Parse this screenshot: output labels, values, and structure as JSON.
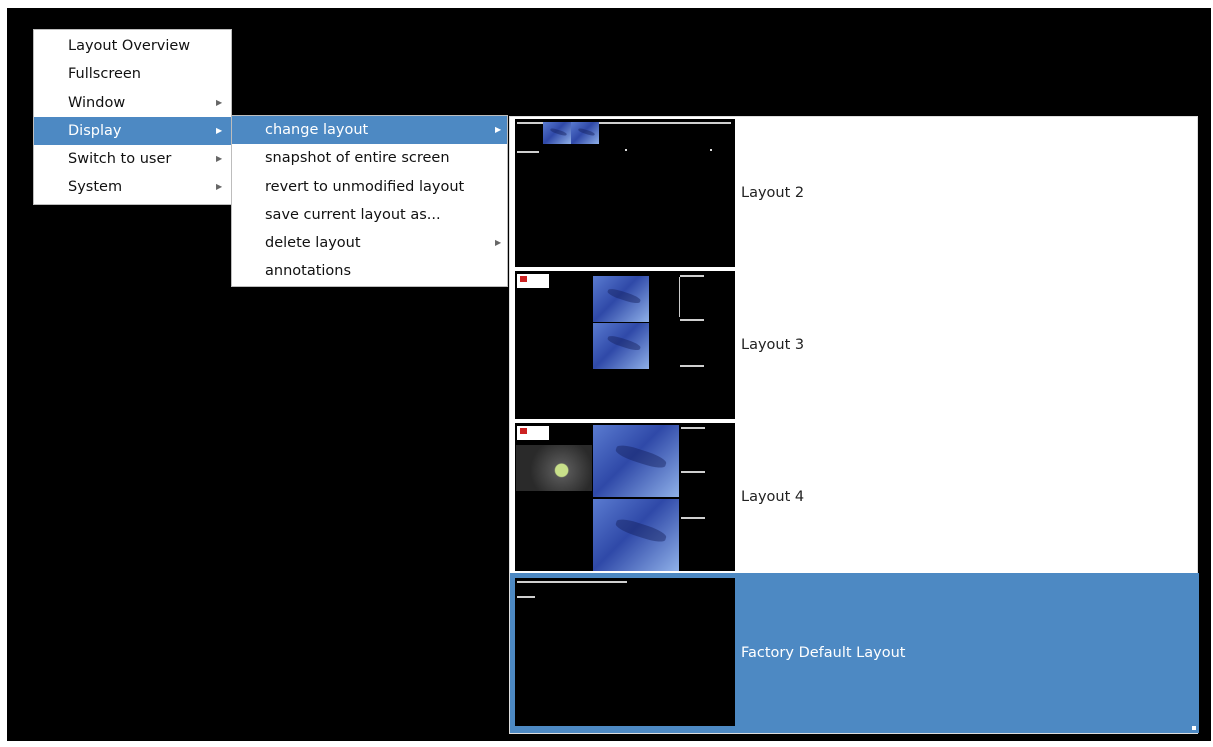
{
  "main_menu": {
    "items": [
      {
        "label": "Layout Overview",
        "has_submenu": false,
        "highlighted": false
      },
      {
        "label": "Fullscreen",
        "has_submenu": false,
        "highlighted": false
      },
      {
        "label": "Window",
        "has_submenu": true,
        "highlighted": false
      },
      {
        "label": "Display",
        "has_submenu": true,
        "highlighted": true
      },
      {
        "label": "Switch to user",
        "has_submenu": true,
        "highlighted": false
      },
      {
        "label": "System",
        "has_submenu": true,
        "highlighted": false
      }
    ]
  },
  "display_menu": {
    "items": [
      {
        "label": "change layout",
        "has_submenu": true,
        "highlighted": true
      },
      {
        "label": "snapshot of entire screen",
        "has_submenu": false,
        "highlighted": false
      },
      {
        "label": "revert to unmodified layout",
        "has_submenu": false,
        "highlighted": false
      },
      {
        "label": "save current layout as...",
        "has_submenu": false,
        "highlighted": false
      },
      {
        "label": "delete layout",
        "has_submenu": true,
        "highlighted": false
      },
      {
        "label": "annotations",
        "has_submenu": false,
        "highlighted": false
      }
    ]
  },
  "layouts": {
    "items": [
      {
        "label": "Layout 2",
        "selected": false
      },
      {
        "label": "Layout 3",
        "selected": false
      },
      {
        "label": "Layout 4",
        "selected": false
      },
      {
        "label": "Factory Default Layout",
        "selected": true
      }
    ]
  },
  "icons": {
    "submenu_arrow": "chevron-right-icon",
    "resize_handle": "resize-grip-icon"
  },
  "colors": {
    "background": "#000000",
    "menu_bg": "#ffffff",
    "highlight": "#4d89c3",
    "highlight_text": "#ffffff"
  }
}
